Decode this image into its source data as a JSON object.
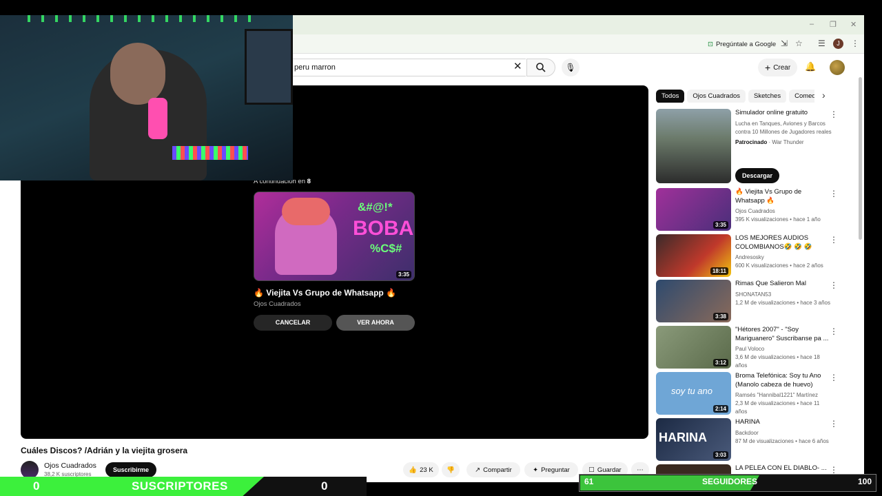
{
  "window": {
    "minimize": "–",
    "restore": "❐",
    "close": "✕"
  },
  "toolbar": {
    "google_label": "Pregúntale a Google",
    "profile_initial": "J"
  },
  "search": {
    "query": "peru marron"
  },
  "header": {
    "create_label": "Crear"
  },
  "player": {
    "up_next_prefix": "A continuación en",
    "countdown": "8",
    "next_title": "🔥 Viejita Vs Grupo de Whatsapp 🔥",
    "next_channel": "Ojos Cuadrados",
    "next_duration": "3:35",
    "cancel_label": "CANCELAR",
    "watch_label": "VER AHORA",
    "thumb_text_1": "&#@!*",
    "thumb_text_2": "BOBA",
    "thumb_text_3": "%C$#"
  },
  "video": {
    "title": "Cuáles Discos? /Adrián y la viejita grosera",
    "channel": "Ojos Cuadrados",
    "subscribers": "38,2 K suscriptores",
    "subscribe_label": "Suscribirme",
    "likes": "23 K",
    "share_label": "Compartir",
    "ask_label": "Preguntar",
    "save_label": "Guardar"
  },
  "chips": [
    "Todos",
    "Ojos Cuadrados",
    "Sketches",
    "Comed"
  ],
  "ad": {
    "title": "Simulador online gratuito",
    "desc": "Lucha en Tanques, Aviones y Barcos contra 10 Millones de Jugadores reales",
    "sponsored": "Patrocinado",
    "advertiser": "War Thunder",
    "cta": "Descargar"
  },
  "recommendations": [
    {
      "title": "🔥 Viejita Vs Grupo de Whatsapp 🔥",
      "channel": "Ojos Cuadrados",
      "views": "395 K visualizaciones",
      "age": "hace 1 año",
      "duration": "3:35",
      "color": "#a0309a"
    },
    {
      "title": "LOS MEJORES AUDIOS COLOMBIANOS🤣 🤣 🤣",
      "channel": "Andresosky",
      "views": "600 K visualizaciones",
      "age": "hace 2 años",
      "duration": "18:11",
      "color": "#c0392b"
    },
    {
      "title": "Rimas Que Salieron Mal",
      "channel": "SHONATAN53",
      "views": "1,2 M de visualizaciones",
      "age": "hace 3 años",
      "duration": "3:38",
      "color": "#2e4a6e"
    },
    {
      "title": "\"Hétores 2007\" - \"Soy Mariguanero\" Suscribanse pa ...",
      "channel": "Paul Voloco",
      "views": "3,6 M de visualizaciones",
      "age": "hace 18 años",
      "duration": "3:12",
      "color": "#6d7a5a"
    },
    {
      "title": "Broma Telefónica: Soy tu Ano (Manolo cabeza de huevo)",
      "channel": "Ramsés \"Hannibal1221\" Martínez",
      "views": "2,3 M de visualizaciones",
      "age": "hace 11 años",
      "duration": "2:14",
      "color": "#6fa6d6",
      "thumb_text": "soy tu ano"
    },
    {
      "title": "HARINA",
      "channel": "Backdoor",
      "views": "87 M de visualizaciones",
      "age": "hace 6 años",
      "duration": "3:03",
      "color": "#1c2a44",
      "thumb_text": "HARINA"
    },
    {
      "title": "LA PELEA CON EL DIABLO- ... MEZA",
      "channel": "",
      "views": "",
      "age": "",
      "duration": "",
      "color": "#3a2a20"
    }
  ],
  "overlay": {
    "subs_current": "0",
    "subs_label": "SUSCRIPTORES",
    "subs_goal": "0",
    "followers_current": "61",
    "followers_label": "SEGUIDORES",
    "followers_goal": "100"
  }
}
